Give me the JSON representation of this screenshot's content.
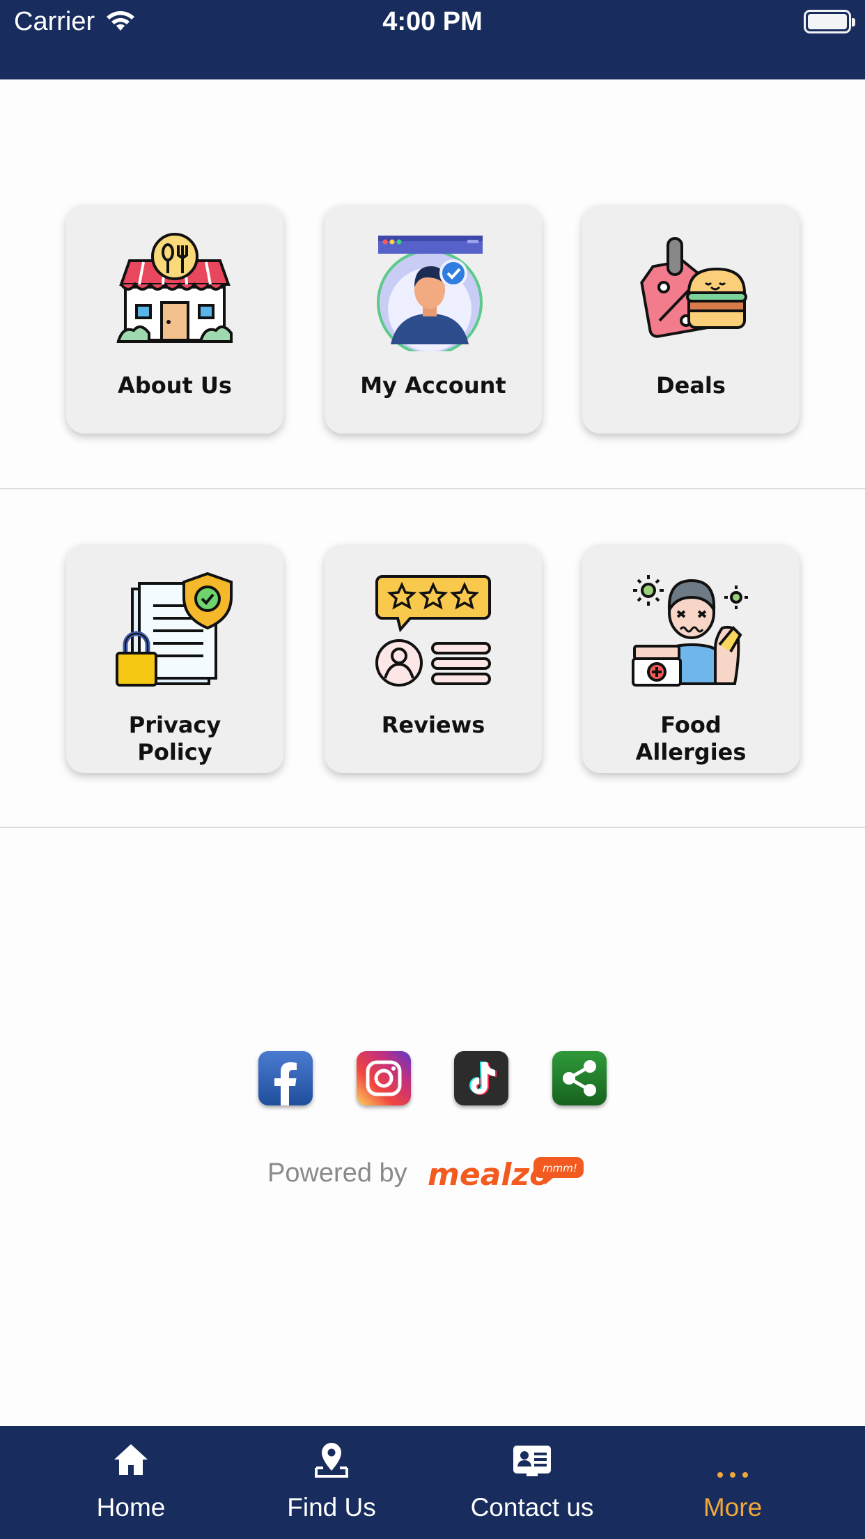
{
  "status_bar": {
    "carrier": "Carrier",
    "time": "4:00 PM"
  },
  "menu": {
    "row1": [
      {
        "label": "About Us",
        "icon": "restaurant-store-icon"
      },
      {
        "label": "My Account",
        "icon": "verified-user-icon"
      },
      {
        "label": "Deals",
        "icon": "price-tag-burger-icon"
      }
    ],
    "row2": [
      {
        "label_line1": "Privacy",
        "label_line2": "Policy",
        "icon": "privacy-document-icon"
      },
      {
        "label": "Reviews",
        "icon": "star-reviews-icon"
      },
      {
        "label_line1": "Food",
        "label_line2": "Allergies",
        "icon": "food-allergy-icon"
      }
    ]
  },
  "social": [
    {
      "name": "facebook",
      "icon": "facebook-icon",
      "color": "#2f5ea8"
    },
    {
      "name": "instagram",
      "icon": "instagram-icon",
      "color": "#c13584"
    },
    {
      "name": "tiktok",
      "icon": "tiktok-icon",
      "color": "#2a2a2a"
    },
    {
      "name": "share",
      "icon": "share-icon",
      "color": "#1f7a2a"
    }
  ],
  "footer": {
    "powered_by": "Powered by",
    "brand": "mealzo",
    "brand_badge": "mmm!",
    "brand_color": "#f25a1f"
  },
  "tab_bar": {
    "items": [
      {
        "label": "Home",
        "icon": "home-icon"
      },
      {
        "label": "Find Us",
        "icon": "location-pin-icon"
      },
      {
        "label": "Contact us",
        "icon": "contact-card-icon"
      },
      {
        "label": "More",
        "icon": "more-dots-icon"
      }
    ],
    "active": "More",
    "active_color": "#f0a83a",
    "background": "#182d5e"
  }
}
